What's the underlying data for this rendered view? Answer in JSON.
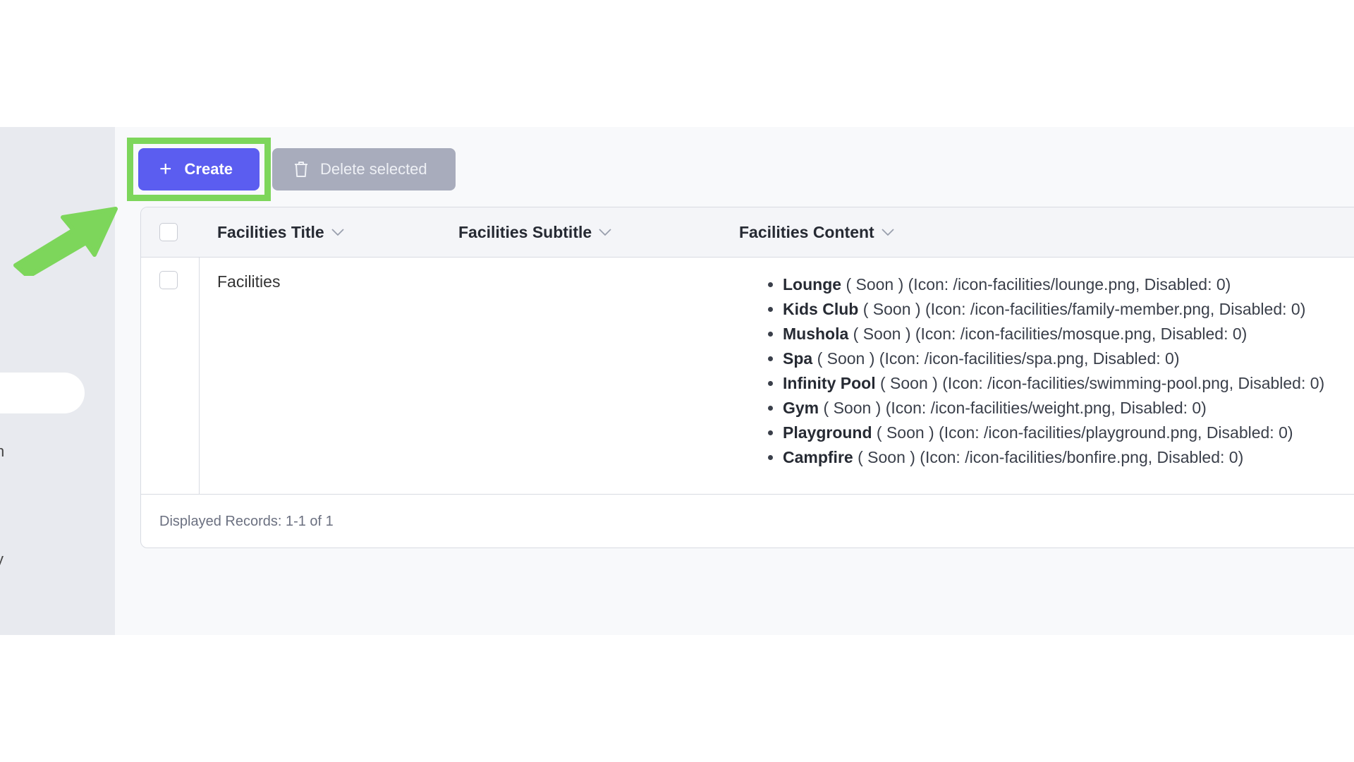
{
  "sidebar": {
    "fragments": [
      "n",
      "y"
    ]
  },
  "toolbar": {
    "create_label": "Create",
    "delete_label": "Delete selected"
  },
  "table": {
    "columns": [
      "Facilities Title",
      "Facilities Subtitle",
      "Facilities Content"
    ],
    "rows": [
      {
        "title": "Facilities",
        "subtitle": "",
        "content": [
          {
            "name": "Lounge",
            "detail": "( Soon ) (Icon: /icon-facilities/lounge.png, Disabled: 0)"
          },
          {
            "name": "Kids Club",
            "detail": "( Soon ) (Icon: /icon-facilities/family-member.png, Disabled: 0)"
          },
          {
            "name": "Mushola",
            "detail": "( Soon ) (Icon: /icon-facilities/mosque.png, Disabled: 0)"
          },
          {
            "name": "Spa",
            "detail": "( Soon ) (Icon: /icon-facilities/spa.png, Disabled: 0)"
          },
          {
            "name": "Infinity Pool",
            "detail": "( Soon ) (Icon: /icon-facilities/swimming-pool.png, Disabled: 0)"
          },
          {
            "name": "Gym",
            "detail": "( Soon ) (Icon: /icon-facilities/weight.png, Disabled: 0)"
          },
          {
            "name": "Playground",
            "detail": "( Soon ) (Icon: /icon-facilities/playground.png, Disabled: 0)"
          },
          {
            "name": "Campfire",
            "detail": "( Soon ) (Icon: /icon-facilities/bonfire.png, Disabled: 0)"
          }
        ]
      }
    ],
    "footer": "Displayed Records: 1-1 of 1"
  },
  "icons": {
    "create": "plus-icon",
    "delete": "trash-icon",
    "sort": "chevron-down-icon",
    "annotation": "arrow-pointer-icon"
  },
  "colors": {
    "primary": "#5b5df0",
    "disabled_button": "#a8acbc",
    "highlight": "#7dd65b",
    "sidebar": "#e8eaef"
  }
}
